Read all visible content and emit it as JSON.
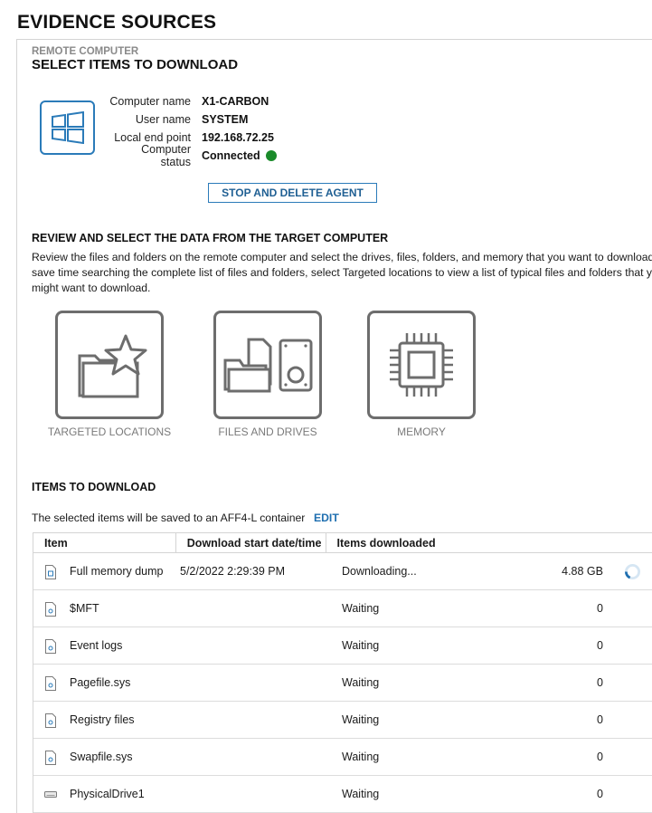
{
  "page_title": "EVIDENCE SOURCES",
  "section": {
    "eyebrow": "REMOTE COMPUTER",
    "title": "SELECT ITEMS TO DOWNLOAD"
  },
  "computer_info": {
    "icon": "windows-icon",
    "rows": [
      {
        "label": "Computer name",
        "value": "X1-CARBON"
      },
      {
        "label": "User name",
        "value": "SYSTEM"
      },
      {
        "label": "Local end point",
        "value": "192.168.72.25"
      },
      {
        "label": "Computer status",
        "value": "Connected"
      }
    ],
    "status_color": "#1a8a2a"
  },
  "stop_button": "STOP AND DELETE AGENT",
  "review": {
    "title": "REVIEW AND SELECT THE DATA FROM THE TARGET COMPUTER",
    "lines": [
      "Review the files and folders on the remote computer and select the drives, files, folders, and memory that you want to download. To",
      "save time searching the complete list of files and folders, select Targeted locations to view a list of typical files and folders that you",
      "might want to download."
    ]
  },
  "tiles": [
    {
      "label": "TARGETED LOCATIONS",
      "icon": "folder-star-icon"
    },
    {
      "label": "FILES AND DRIVES",
      "icon": "files-drive-icon"
    },
    {
      "label": "MEMORY",
      "icon": "chip-icon"
    }
  ],
  "items": {
    "title": "ITEMS TO DOWNLOAD",
    "note": "The selected items will be saved to an AFF4-L container",
    "edit": "EDIT",
    "columns": [
      "Item",
      "Download start date/time",
      "Items downloaded"
    ],
    "rows": [
      {
        "icon": "memory-file-icon",
        "name": "Full memory dump",
        "date": "5/2/2022 2:29:39 PM",
        "state": "Downloading...",
        "amount": "4.88 GB",
        "spinner": true
      },
      {
        "icon": "file-icon",
        "name": "$MFT",
        "date": "",
        "state": "Waiting",
        "amount": "0"
      },
      {
        "icon": "file-icon",
        "name": "Event logs",
        "date": "",
        "state": "Waiting",
        "amount": "0"
      },
      {
        "icon": "file-icon",
        "name": "Pagefile.sys",
        "date": "",
        "state": "Waiting",
        "amount": "0"
      },
      {
        "icon": "file-icon",
        "name": "Registry files",
        "date": "",
        "state": "Waiting",
        "amount": "0"
      },
      {
        "icon": "file-icon",
        "name": "Swapfile.sys",
        "date": "",
        "state": "Waiting",
        "amount": "0"
      },
      {
        "icon": "drive-icon",
        "name": "PhysicalDrive1",
        "date": "",
        "state": "Waiting",
        "amount": "0"
      }
    ]
  },
  "colors": {
    "accent": "#2b7bb9",
    "link": "#1f6fb0",
    "tile_border": "#6d6d6d"
  }
}
